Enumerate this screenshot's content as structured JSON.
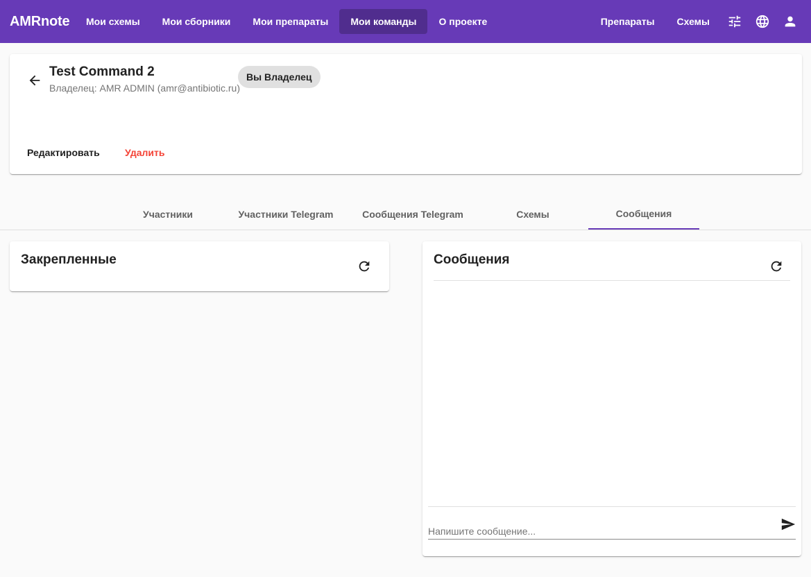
{
  "app": {
    "brand": "AMRnote",
    "nav": [
      "Мои схемы",
      "Мои сборники",
      "Мои препараты",
      "Мои команды",
      "О проекте"
    ],
    "right_nav": [
      "Препараты",
      "Схемы"
    ],
    "icons": [
      "tune-icon",
      "globe-icon",
      "account-icon"
    ],
    "accent_color": "#673ab7"
  },
  "command": {
    "title": "Test Command 2",
    "owner": "Владелец: AMR ADMIN (amr@antibiotic.ru)",
    "role_chip": "Вы Владелец",
    "edit_label": "Редактировать",
    "delete_label": "Удалить",
    "delete_color": "#f44336"
  },
  "tabs": [
    "Участники",
    "Участники Telegram",
    "Сообщения Telegram",
    "Схемы",
    "Сообщения"
  ],
  "active_tab": "Сообщения",
  "pinned": {
    "title": "Закрепленные"
  },
  "messages": {
    "title": "Сообщения",
    "input_placeholder": "Напишите сообщение..."
  }
}
